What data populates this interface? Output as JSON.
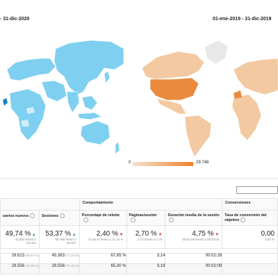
{
  "maps": {
    "left": {
      "date_range": "- 31-dic-2020",
      "color": "#7fd0f0"
    },
    "right": {
      "date_range": "01-ene-2019 - 31-dic-2019",
      "color": "#f3c9a1",
      "accent": "#ea8a3c"
    },
    "legend": {
      "min": "0",
      "max": "29.748"
    }
  },
  "table": {
    "groups": {
      "behavior": "Comportamiento",
      "conversions": "Conversiones"
    },
    "columns": [
      {
        "label": "uarios nuevos"
      },
      {
        "label": "Sesiones"
      },
      {
        "label": "Porcentaje de rebote"
      },
      {
        "label": "Páginas/sesión"
      },
      {
        "label": "Duración media de la sesión"
      },
      {
        "label": "Tasa de conversión del objetivo"
      }
    ],
    "totals": [
      {
        "value": "49,74 %",
        "trend": "up",
        "sub1": "42.563 frente a",
        "sub2": "28.424"
      },
      {
        "value": "53,37 %",
        "trend": "up",
        "sub1": "58.798 frente a",
        "sub2": "38.337"
      },
      {
        "value": "2,40 %",
        "trend": "down",
        "sub1": "73,15 % frente a 71,44 %",
        "sub2": ""
      },
      {
        "value": "2,70 %",
        "trend": "down",
        "sub1": "2,72 frente a 2,79",
        "sub2": ""
      },
      {
        "value": "4,75 %",
        "trend": "down",
        "sub1": "00:01:59 frente a 00:02:05",
        "sub2": ""
      },
      {
        "value": "0,00",
        "trend": "",
        "sub1": "0,00 %",
        "sub2": ""
      }
    ],
    "rows": [
      {
        "cells": [
          "29.613",
          "45.363",
          "67,85 %",
          "3,14",
          "00:02:28",
          ""
        ],
        "pcts": [
          "(69,57 %)",
          "(77,15 %)",
          "",
          "",
          "",
          ""
        ]
      },
      {
        "cells": [
          "29.556",
          "29.556",
          "65,30 %",
          "3,19",
          "00:02:09",
          ""
        ],
        "pcts": [
          "(70,48 %)",
          "(77,15 %)",
          "",
          "",
          "",
          ""
        ]
      }
    ]
  }
}
